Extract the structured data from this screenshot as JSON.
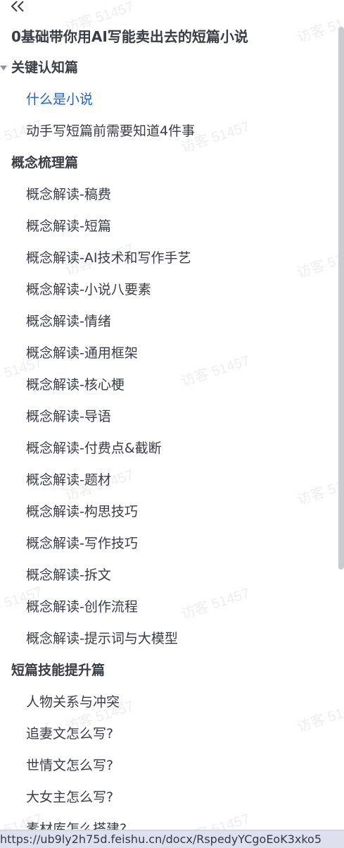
{
  "header": {
    "collapse_icon": "double-chevron-left-icon",
    "title": "0基础带你用AI写能卖出去的短篇小说"
  },
  "toc": {
    "sections": [
      {
        "label": "关键认知篇",
        "expanded": true,
        "items": [
          {
            "label": "什么是小说",
            "active": true
          },
          {
            "label": "动手写短篇前需要知道4件事"
          }
        ]
      },
      {
        "label": "概念梳理篇",
        "items": [
          {
            "label": "概念解读-稿费"
          },
          {
            "label": "概念解读-短篇"
          },
          {
            "label": "概念解读-AI技术和写作手艺"
          },
          {
            "label": "概念解读-小说八要素"
          },
          {
            "label": "概念解读-情绪"
          },
          {
            "label": "概念解读-通用框架"
          },
          {
            "label": "概念解读-核心梗"
          },
          {
            "label": "概念解读-导语"
          },
          {
            "label": "概念解读-付费点&截断"
          },
          {
            "label": "概念解读-题材"
          },
          {
            "label": "概念解读-构思技巧"
          },
          {
            "label": "概念解读-写作技巧"
          },
          {
            "label": "概念解读-拆文"
          },
          {
            "label": "概念解读-创作流程"
          },
          {
            "label": "概念解读-提示词与大模型"
          }
        ]
      },
      {
        "label": "短篇技能提升篇",
        "items": [
          {
            "label": "人物关系与冲突"
          },
          {
            "label": "追妻文怎么写?"
          },
          {
            "label": "世情文怎么写?"
          },
          {
            "label": "大女主怎么写?"
          },
          {
            "label": "素材库怎么搭建?"
          }
        ]
      }
    ]
  },
  "watermark_text": "访客 51457",
  "status_url": "https://ub9ly2h75d.feishu.cn/docx/RspedyYCgoEoK3xko5"
}
